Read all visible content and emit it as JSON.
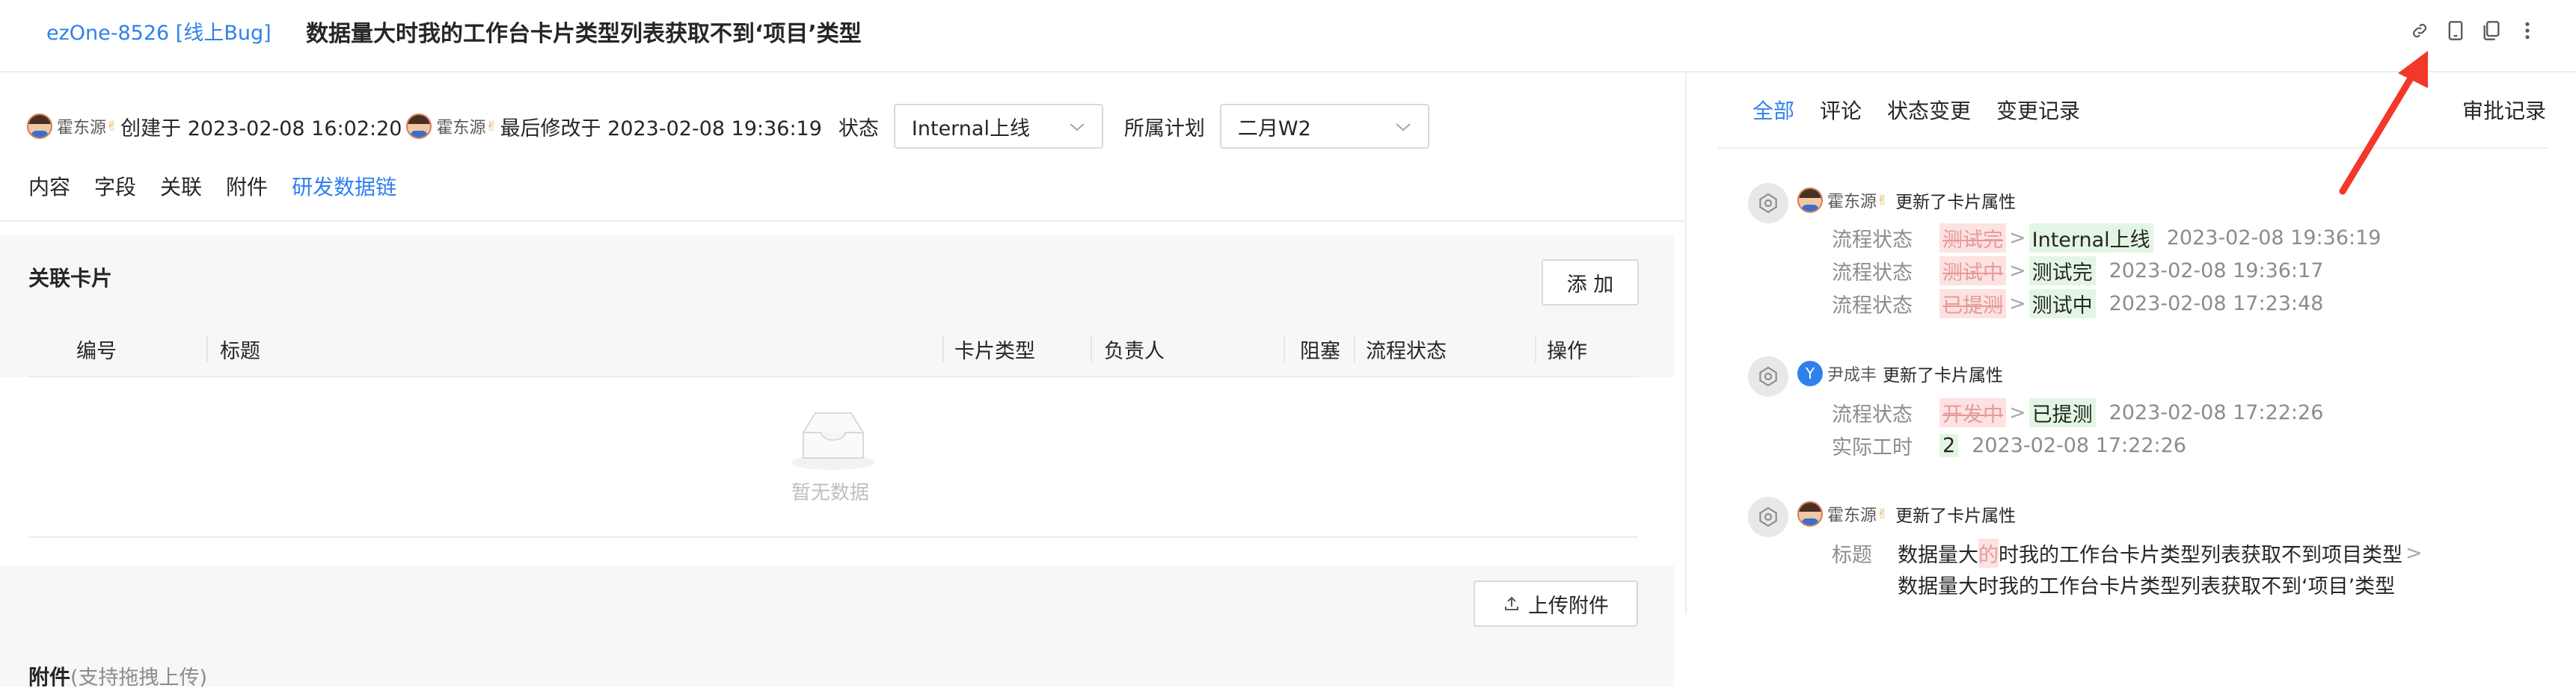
{
  "header": {
    "card_id": "ezOne-8526 [线上Bug]",
    "title": "数据量大时我的工作台卡片类型列表获取不到‘项目’类型",
    "icons": [
      "link-icon",
      "mobile-icon",
      "copy-icon",
      "more-icon"
    ]
  },
  "meta": {
    "creator": "霍东源",
    "created_text": "创建于 2023-02-08 16:02:20",
    "modifier": "霍东源",
    "modified_text": "最后修改于 2023-02-08 19:36:19",
    "status_label": "状态",
    "status_value": "Internal上线",
    "plan_label": "所属计划",
    "plan_value": "二月W2"
  },
  "subnav": [
    "内容",
    "字段",
    "关联",
    "附件",
    "研发数据链"
  ],
  "related": {
    "title": "关联卡片",
    "add_button": "添 加",
    "columns": [
      "编号",
      "标题",
      "卡片类型",
      "负责人",
      "阻塞",
      "流程状态",
      "操作"
    ],
    "empty_text": "暂无数据"
  },
  "attachments": {
    "title": "附件",
    "hint": "(支持拖拽上传)",
    "upload_button": "上传附件"
  },
  "activity": {
    "tabs": [
      "全部",
      "评论",
      "状态变更",
      "变更记录"
    ],
    "approval_tab": "审批记录",
    "entries": [
      {
        "user": "霍东源",
        "verb": "更新了卡片属性",
        "rows": [
          {
            "field": "流程状态",
            "old": "测试完",
            "new": "Internal上线",
            "time": "2023-02-08 19:36:19"
          },
          {
            "field": "流程状态",
            "old": "测试中",
            "new": "测试完",
            "time": "2023-02-08 19:36:17"
          },
          {
            "field": "流程状态",
            "old": "已提测",
            "new": "测试中",
            "time": "2023-02-08 17:23:48"
          }
        ]
      },
      {
        "user": "尹成丰",
        "avatar_letter": "Y",
        "verb": "更新了卡片属性",
        "rows": [
          {
            "field": "流程状态",
            "old": "开发中",
            "new": "已提测",
            "time": "2023-02-08 17:22:26"
          },
          {
            "field": "实际工时",
            "old": "",
            "new": "2",
            "time": "2023-02-08 17:22:26"
          }
        ]
      },
      {
        "user": "霍东源",
        "verb": "更新了卡片属性",
        "title_field": "标题",
        "title_old_pre": "数据量大",
        "title_old_hl": "的",
        "title_old_post": "时我的工作台卡片类型列表获取不到项目类型",
        "title_new": "数据量大时我的工作台卡片类型列表获取不到‘项目’类型"
      }
    ]
  },
  "colors": {
    "accent": "#2f80ed",
    "arrow": "#f2382a"
  }
}
